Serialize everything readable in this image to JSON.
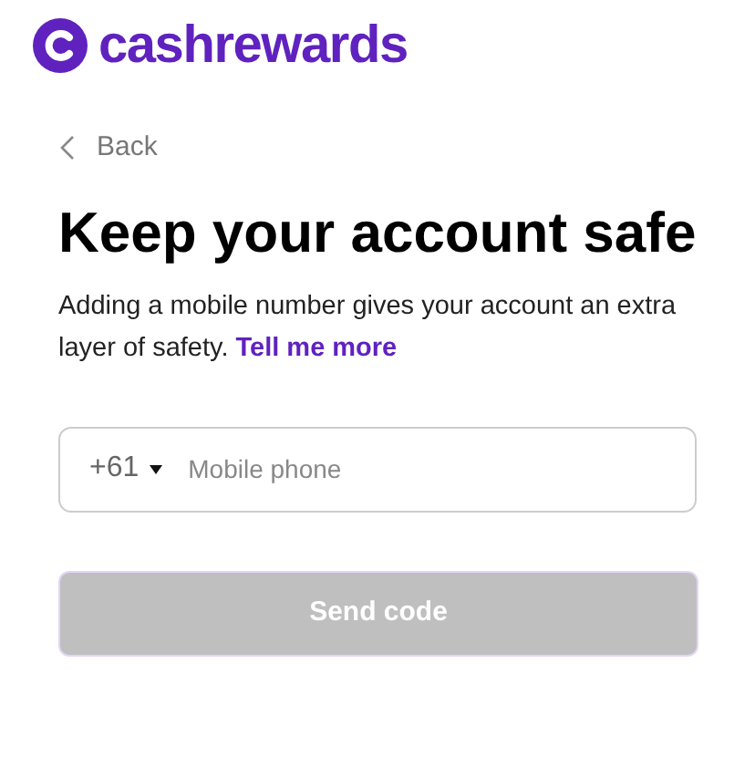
{
  "logo": {
    "text": "cashrewards"
  },
  "back_link": {
    "label": "Back"
  },
  "heading": "Keep your account safe",
  "description": {
    "text": "Adding a mobile number gives your account an extra layer of safety.",
    "link": "Tell me more"
  },
  "phone_field": {
    "country_code": "+61",
    "placeholder": "Mobile phone"
  },
  "send_button": {
    "label": "Send code",
    "disabled": true
  }
}
